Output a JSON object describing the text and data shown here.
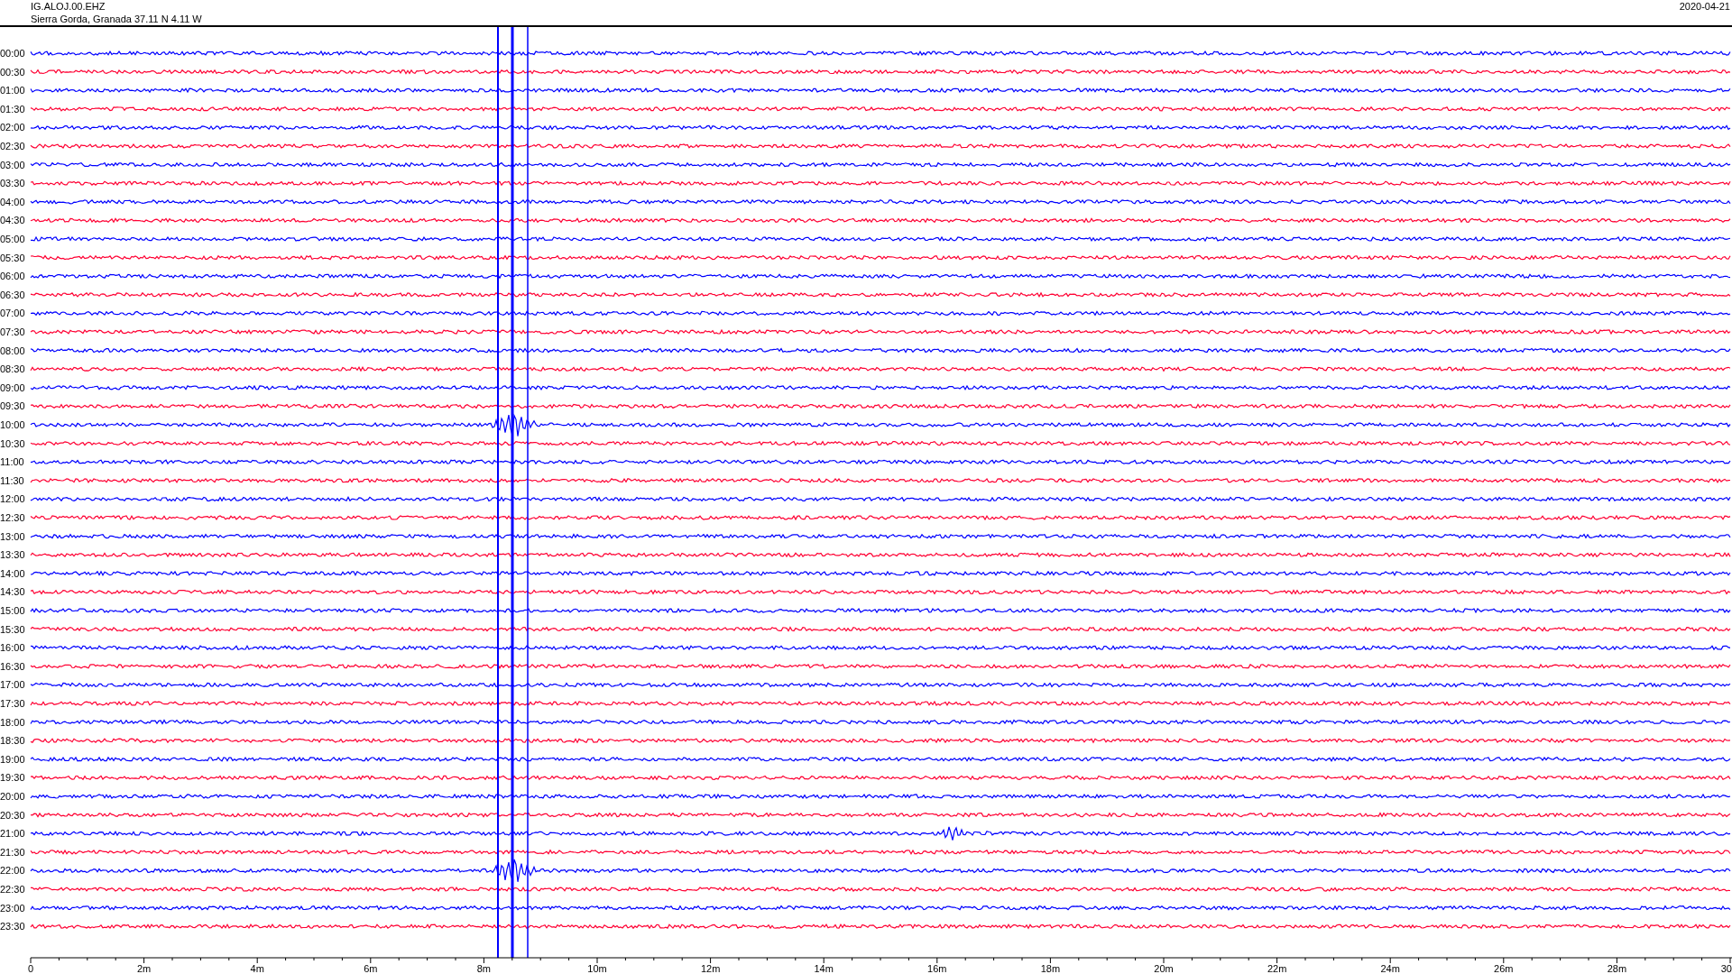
{
  "header": {
    "station": "IG.ALOJ.00.EHZ",
    "location": "Sierra Gorda, Granada  37.11 N 4.11 W",
    "date": "2020-04-21"
  },
  "rows": [
    {
      "time": "00:00",
      "color": "#0000ff"
    },
    {
      "time": "00:30",
      "color": "#ff0033"
    },
    {
      "time": "01:00",
      "color": "#0000ff"
    },
    {
      "time": "01:30",
      "color": "#ff0033"
    },
    {
      "time": "02:00",
      "color": "#0000ff"
    },
    {
      "time": "02:30",
      "color": "#ff0033"
    },
    {
      "time": "03:00",
      "color": "#0000ff"
    },
    {
      "time": "03:30",
      "color": "#ff0033"
    },
    {
      "time": "04:00",
      "color": "#0000ff"
    },
    {
      "time": "04:30",
      "color": "#ff0033"
    },
    {
      "time": "05:00",
      "color": "#0000ff"
    },
    {
      "time": "05:30",
      "color": "#ff0033"
    },
    {
      "time": "06:00",
      "color": "#0000ff"
    },
    {
      "time": "06:30",
      "color": "#ff0033"
    },
    {
      "time": "07:00",
      "color": "#0000ff"
    },
    {
      "time": "07:30",
      "color": "#ff0033"
    },
    {
      "time": "08:00",
      "color": "#0000ff"
    },
    {
      "time": "08:30",
      "color": "#ff0033"
    },
    {
      "time": "09:00",
      "color": "#0000ff"
    },
    {
      "time": "09:30",
      "color": "#ff0033"
    },
    {
      "time": "10:00",
      "color": "#0000ff"
    },
    {
      "time": "10:30",
      "color": "#ff0033"
    },
    {
      "time": "11:00",
      "color": "#0000ff"
    },
    {
      "time": "11:30",
      "color": "#ff0033"
    },
    {
      "time": "12:00",
      "color": "#0000ff"
    },
    {
      "time": "12:30",
      "color": "#ff0033"
    },
    {
      "time": "13:00",
      "color": "#0000ff"
    },
    {
      "time": "13:30",
      "color": "#ff0033"
    },
    {
      "time": "14:00",
      "color": "#0000ff"
    },
    {
      "time": "14:30",
      "color": "#ff0033"
    },
    {
      "time": "15:00",
      "color": "#0000ff"
    },
    {
      "time": "15:30",
      "color": "#ff0033"
    },
    {
      "time": "16:00",
      "color": "#0000ff"
    },
    {
      "time": "16:30",
      "color": "#ff0033"
    },
    {
      "time": "17:00",
      "color": "#0000ff"
    },
    {
      "time": "17:30",
      "color": "#ff0033"
    },
    {
      "time": "18:00",
      "color": "#0000ff"
    },
    {
      "time": "18:30",
      "color": "#ff0033"
    },
    {
      "time": "19:00",
      "color": "#0000ff"
    },
    {
      "time": "19:30",
      "color": "#ff0033"
    },
    {
      "time": "20:00",
      "color": "#0000ff"
    },
    {
      "time": "20:30",
      "color": "#ff0033"
    },
    {
      "time": "21:00",
      "color": "#0000ff"
    },
    {
      "time": "21:30",
      "color": "#ff0033"
    },
    {
      "time": "22:00",
      "color": "#0000ff"
    },
    {
      "time": "22:30",
      "color": "#ff0033"
    },
    {
      "time": "23:00",
      "color": "#0000ff"
    },
    {
      "time": "23:30",
      "color": "#ff0033"
    }
  ],
  "x_axis": {
    "labels": [
      "0",
      "2m",
      "4m",
      "6m",
      "8m",
      "10m",
      "12m",
      "14m",
      "16m",
      "18m",
      "20m",
      "22m",
      "24m",
      "26m",
      "28m",
      "30"
    ]
  }
}
